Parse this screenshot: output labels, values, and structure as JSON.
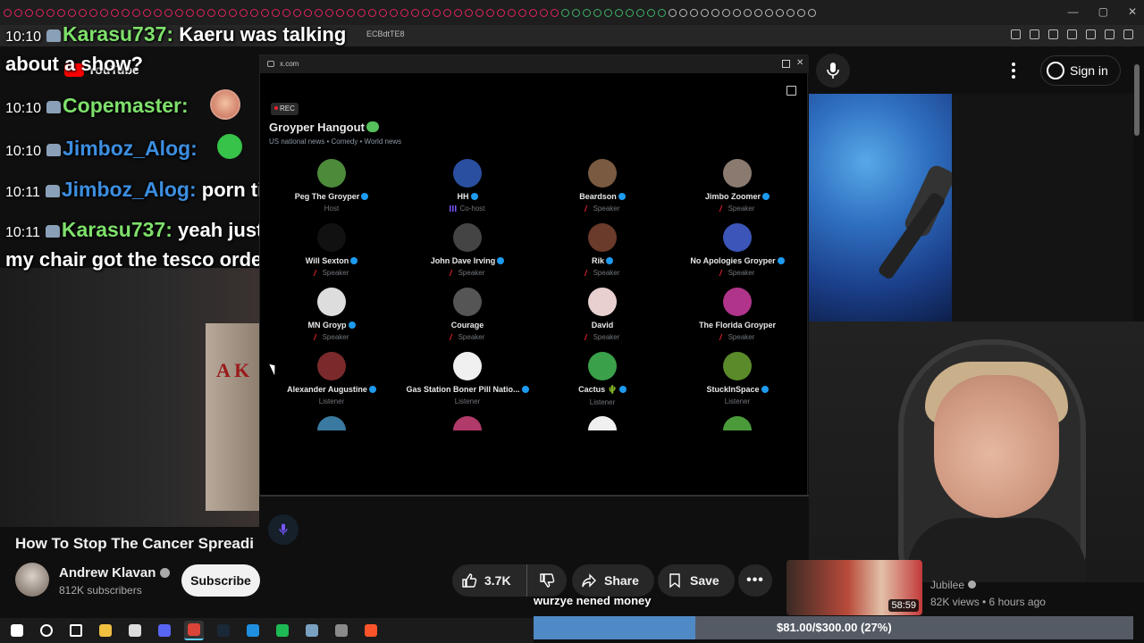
{
  "browser": {
    "url_fragment": "ECBdtTE8"
  },
  "youtube": {
    "logo_text": "YouTube",
    "signin_label": "Sign in",
    "video": {
      "title": "How To Stop The Cancer Spreadi",
      "channel": "Andrew Klavan",
      "subscribers": "812K subscribers",
      "subscribe_label": "Subscribe",
      "likes": "3.7K",
      "share_label": "Share",
      "save_label": "Save",
      "more_label": "•••"
    },
    "recommendation": {
      "duration": "58:59",
      "channel": "Jubilee",
      "meta": "82K views • 6 hours ago"
    },
    "book_text": "A K"
  },
  "chat": [
    {
      "time": "10:10",
      "user": "Karasu737:",
      "message": "Kaeru was talking",
      "user_color": "#7ee06b"
    },
    {
      "time": "",
      "user": "",
      "message": "about a show?",
      "user_color": "#7ee06b"
    },
    {
      "time": "10:10",
      "user": "Copemaster:",
      "message": "",
      "user_color": "#7ee06b"
    },
    {
      "time": "10:10",
      "user": "Jimboz_Alog:",
      "message": "",
      "user_color": "#3c8ee0"
    },
    {
      "time": "10:11",
      "user": "Jimboz_Alog:",
      "message": "porn time",
      "user_color": "#3c8ee0"
    },
    {
      "time": "10:11",
      "user": "Karasu737:",
      "message": "yeah just chillin in",
      "user_color": "#7ee06b"
    },
    {
      "time": "",
      "user": "",
      "message": "my chair got the tesco ordered",
      "user_color": "#7ee06b"
    }
  ],
  "space": {
    "host_domain": "x.com",
    "rec_label": "REC",
    "title": "Groyper Hangout",
    "subtitle": "US national news • Comedy • World news",
    "participants": [
      {
        "name": "Peg The Groyper",
        "role": "Host",
        "verified": true,
        "color": "#4d8a3a"
      },
      {
        "name": "HH",
        "role": "Co-host",
        "verified": true,
        "color": "#2a4fa0"
      },
      {
        "name": "Beardson",
        "role": "Speaker",
        "verified": true,
        "color": "#7a5a40"
      },
      {
        "name": "Jimbo Zoomer",
        "role": "Speaker",
        "verified": true,
        "color": "#8a7a70"
      },
      {
        "name": "Will Sexton",
        "role": "Speaker",
        "verified": true,
        "color": "#111111"
      },
      {
        "name": "John Dave Irving",
        "role": "Speaker",
        "verified": true,
        "color": "#444444"
      },
      {
        "name": "Rik",
        "role": "Speaker",
        "verified": true,
        "color": "#6a3a2a"
      },
      {
        "name": "No Apologies Groyper",
        "role": "Speaker",
        "verified": true,
        "color": "#3b55b8"
      },
      {
        "name": "MN Groyp",
        "role": "Speaker",
        "verified": true,
        "color": "#dddddd"
      },
      {
        "name": "Courage",
        "role": "Speaker",
        "verified": false,
        "color": "#555555"
      },
      {
        "name": "David",
        "role": "Speaker",
        "verified": false,
        "color": "#e8d0d0"
      },
      {
        "name": "The Florida Groyper",
        "role": "Speaker",
        "verified": false,
        "color": "#b0348a"
      },
      {
        "name": "Alexander Augustine",
        "role": "Listener",
        "verified": true,
        "color": "#7a2a2a"
      },
      {
        "name": "Gas Station Boner Pill Natio...",
        "role": "Listener",
        "verified": true,
        "color": "#f0f0f0"
      },
      {
        "name": "Cactus 🌵",
        "role": "Listener",
        "verified": true,
        "color": "#3aa04a"
      },
      {
        "name": "StuckInSpace",
        "role": "Listener",
        "verified": true,
        "color": "#5a8a2a"
      },
      {
        "name": "",
        "role": "",
        "verified": false,
        "color": "#3a7aa0"
      },
      {
        "name": "",
        "role": "",
        "verified": false,
        "color": "#b03a6a"
      },
      {
        "name": "",
        "role": "",
        "verified": false,
        "color": "#f0f0f0"
      },
      {
        "name": "",
        "role": "",
        "verified": false,
        "color": "#4a9a3a"
      }
    ]
  },
  "stream": {
    "donation_message": "wurzye nened money",
    "goal_text": "$81.00/$300.00 (27%)",
    "goal_progress": 0.27
  },
  "colors": {
    "accent": "#1d9bf0",
    "mute": "#f4212e",
    "yt_red": "#ff0000"
  },
  "taskbar": [
    "windows-icon",
    "search-icon",
    "task-view-icon",
    "file-explorer-icon",
    "obs-icon",
    "discord-icon",
    "chrome-icon",
    "steam-icon",
    "edge-icon",
    "spotify-icon",
    "app-icon",
    "app-icon",
    "brave-icon"
  ]
}
